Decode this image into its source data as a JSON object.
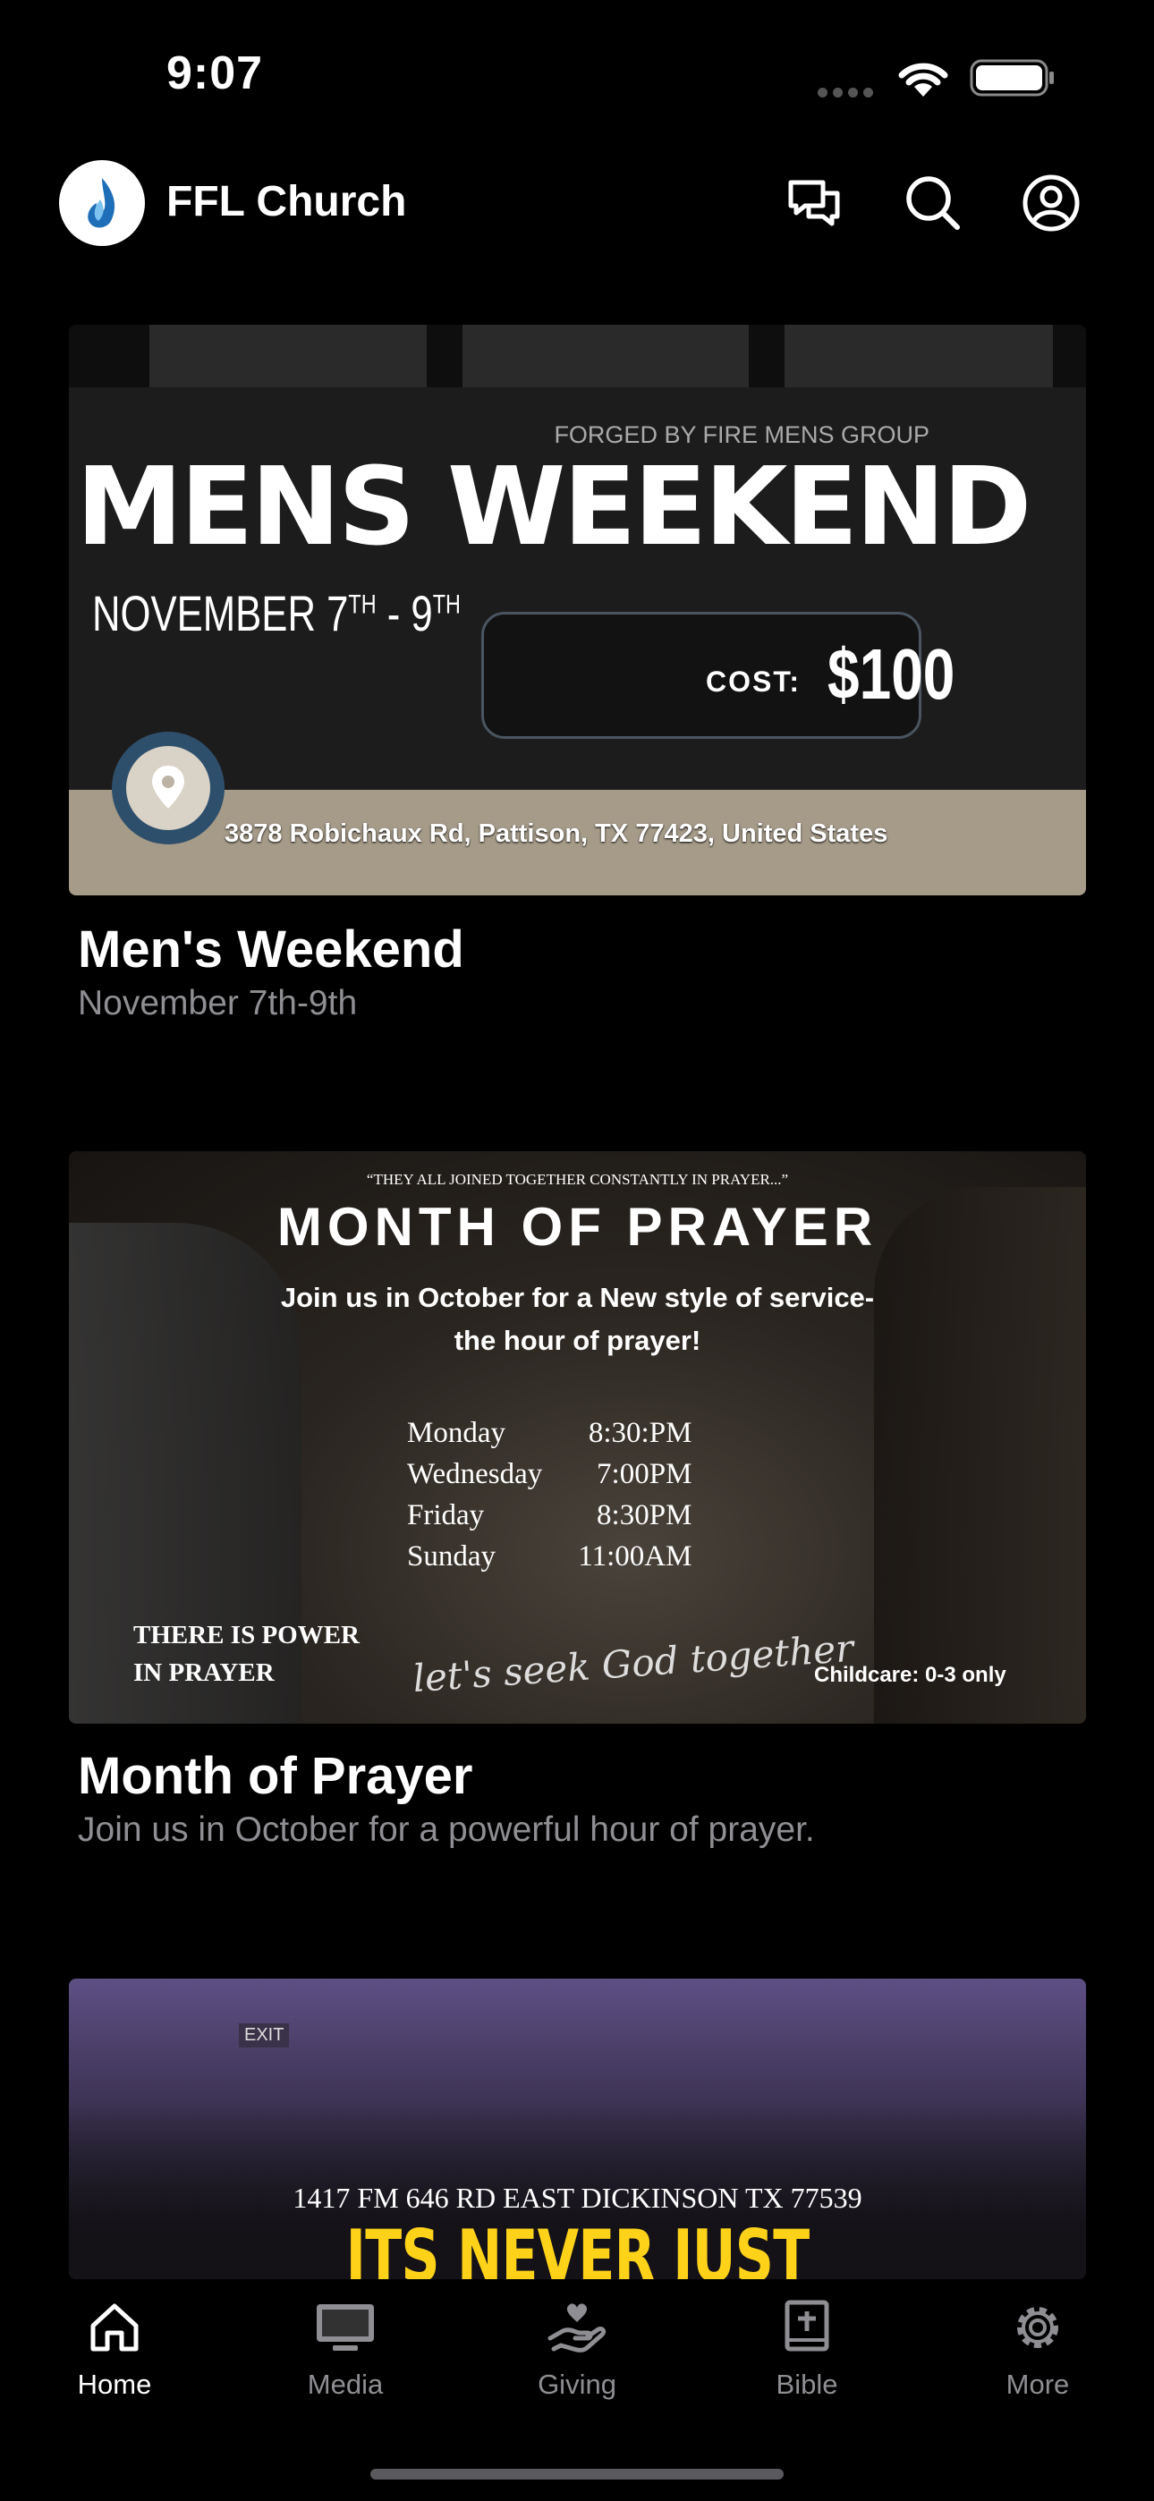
{
  "status": {
    "time": "9:07"
  },
  "header": {
    "title": "FFL Church"
  },
  "cards": [
    {
      "title": "Men's Weekend",
      "subtitle": "November 7th-9th",
      "image": {
        "group": "FORGED BY FIRE MENS GROUP",
        "headline": "MENS WEEKEND",
        "dates_main": "NOVEMBER 7",
        "dates_sup1": "TH",
        "dates_mid": " - 9",
        "dates_sup2": "TH",
        "cost_label": "COST:",
        "cost_value": "$100",
        "address": "3878 Robichaux Rd, Pattison, TX 77423, United States"
      }
    },
    {
      "title": "Month of Prayer",
      "subtitle": "Join us in October for a powerful hour of prayer.",
      "image": {
        "quote": "“THEY ALL JOINED TOGETHER CONSTANTLY IN PRAYER...”",
        "headline": "MONTH OF PRAYER",
        "join_line1": "Join us in October for a New style of service-",
        "join_line2": "the hour of prayer!",
        "schedule": [
          {
            "day": "Monday",
            "time": "8:30:PM"
          },
          {
            "day": "Wednesday",
            "time": "7:00PM"
          },
          {
            "day": "Friday",
            "time": "8:30PM"
          },
          {
            "day": "Sunday",
            "time": "11:00AM"
          }
        ],
        "power_line1": "THERE IS POWER",
        "power_line2": "IN PRAYER",
        "script": "let's seek God together",
        "childcare": "Childcare: 0-3 only"
      }
    },
    {
      "image": {
        "exit_sign": "EXIT",
        "address": "1417 FM 646 RD EAST DICKINSON TX 77539",
        "slogan": "ITS NEVER JUST ANOTHER"
      }
    }
  ],
  "tabs": [
    {
      "label": "Home",
      "icon": "home-icon",
      "active": true
    },
    {
      "label": "Media",
      "icon": "monitor-icon",
      "active": false
    },
    {
      "label": "Giving",
      "icon": "giving-hand-icon",
      "active": false
    },
    {
      "label": "Bible",
      "icon": "bible-icon",
      "active": false
    },
    {
      "label": "More",
      "icon": "gear-icon",
      "active": false
    }
  ],
  "colors": {
    "background": "#000000",
    "subtitle": "#8e8e93",
    "slogan": "#ffd21a",
    "pin": "#2e4f6b"
  }
}
